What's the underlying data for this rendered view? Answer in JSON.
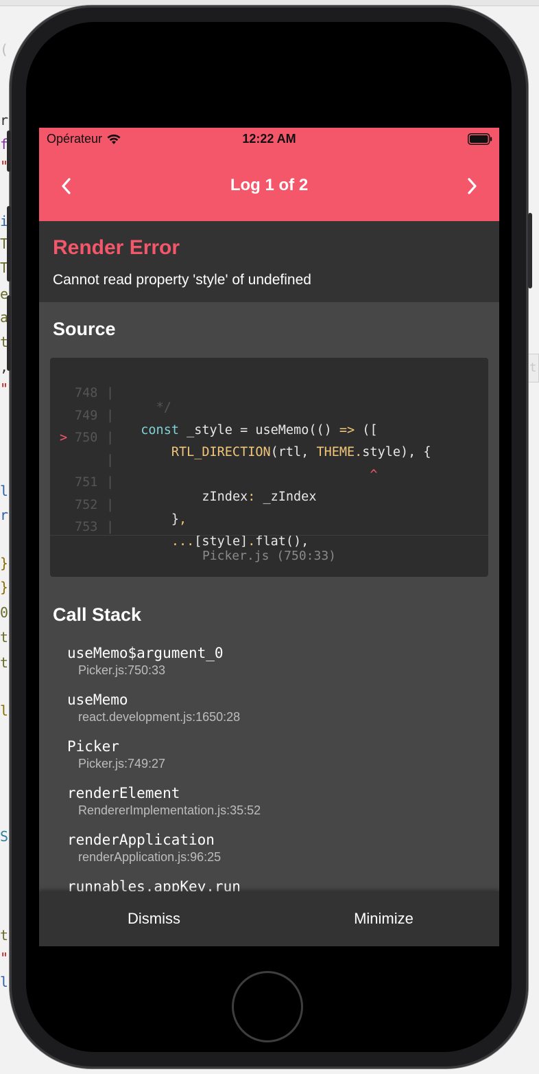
{
  "status_bar": {
    "carrier": "Opérateur",
    "time": "12:22 AM"
  },
  "nav": {
    "title": "Log 1 of 2"
  },
  "error": {
    "title": "Render Error",
    "message": "Cannot read property 'style' of undefined"
  },
  "source": {
    "title": "Source",
    "line_748": "748",
    "line_749": "749",
    "line_750": "750",
    "line_751": "751",
    "line_752": "752",
    "line_753": "753",
    "marker": ">",
    "code_748": "*/",
    "code_749_kw": "const",
    "code_749_a": " _style = useMemo(() ",
    "code_749_arrow": "=>",
    "code_749_b": " ([",
    "code_750_fn": "RTL_DIRECTION",
    "code_750_a": "(rtl, ",
    "code_750_theme": "THEME",
    "code_750_dot": ".",
    "code_750_b": "style), {",
    "caret": "^",
    "code_751_a": "zIndex",
    "code_751_colon": ":",
    "code_751_b": " _zIndex",
    "code_752_a": "}",
    "code_752_comma": ",",
    "code_753_spread": "...",
    "code_753_a": "[style]",
    "code_753_dot": ".",
    "code_753_b": "flat(),",
    "file": "Picker.js (750:33)"
  },
  "call_stack": {
    "title": "Call Stack",
    "frames": [
      {
        "name": "useMemo$argument_0",
        "location": "Picker.js:750:33"
      },
      {
        "name": "useMemo",
        "location": "react.development.js:1650:28"
      },
      {
        "name": "Picker",
        "location": "Picker.js:749:27"
      },
      {
        "name": "renderElement",
        "location": "RendererImplementation.js:35:52"
      },
      {
        "name": "renderApplication",
        "location": "renderApplication.js:96:25"
      },
      {
        "name": "runnables.appKey.run",
        "location": ""
      }
    ]
  },
  "buttons": {
    "dismiss": "Dismiss",
    "minimize": "Minimize"
  },
  "colors": {
    "accent": "#f4566a",
    "panel": "#333333",
    "background": "#474747",
    "code_bg": "#2d2d2d"
  },
  "icons": [
    "wifi-icon",
    "battery-icon",
    "chevron-left-icon",
    "chevron-right-icon"
  ]
}
